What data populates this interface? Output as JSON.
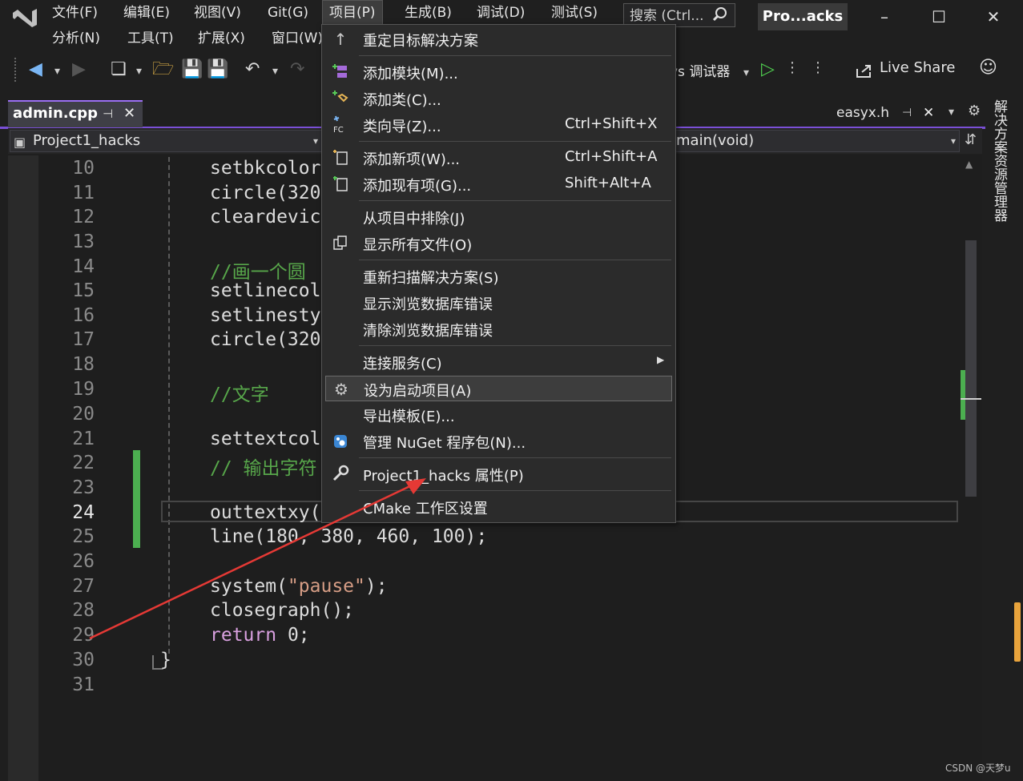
{
  "menubar": {
    "row1": [
      "文件(F)",
      "编辑(E)",
      "视图(V)",
      "Git(G)",
      "项目(P)",
      "生成(B)",
      "调试(D)",
      "测试(S)"
    ],
    "row2": [
      "分析(N)",
      "工具(T)",
      "扩展(X)",
      "窗口(W)"
    ],
    "search_placeholder": "搜索 (Ctrl...",
    "solution_name": "Pro...acks"
  },
  "toolbar": {
    "debugger_label": "vs 调试器",
    "live_share": "Live Share"
  },
  "tabs": {
    "active": "admin.cpp",
    "other": "easyx.h"
  },
  "navbar": {
    "scope": "Project1_hacks",
    "function": "main(void)"
  },
  "editor": {
    "lines": [
      {
        "n": "10",
        "code": "setbkcolor"
      },
      {
        "n": "11",
        "code": "circle(320"
      },
      {
        "n": "12",
        "code": "cleardevic"
      },
      {
        "n": "13",
        "code": ""
      },
      {
        "n": "14",
        "code": "//画一个圆"
      },
      {
        "n": "15",
        "code": "setlinecol"
      },
      {
        "n": "16",
        "code": "setlinesty"
      },
      {
        "n": "17",
        "code": "circle(320"
      },
      {
        "n": "18",
        "code": ""
      },
      {
        "n": "19",
        "code": "//文字"
      },
      {
        "n": "20",
        "code": ""
      },
      {
        "n": "21",
        "code": "settextcol"
      },
      {
        "n": "22",
        "code": "// 输出字符"
      },
      {
        "n": "23",
        "code": ""
      },
      {
        "n": "24",
        "code": "outtextxy("
      },
      {
        "n": "25",
        "code": "line(180, 380, 460, 100);"
      },
      {
        "n": "26",
        "code": ""
      },
      {
        "n": "27",
        "code_pre": "system(",
        "code_str": "\"pause\"",
        "code_post": ");"
      },
      {
        "n": "28",
        "code": "closegraph();"
      },
      {
        "n": "29",
        "code_kw": "return",
        "code_post": " 0;"
      },
      {
        "n": "30",
        "code": "}"
      },
      {
        "n": "31",
        "code": ""
      }
    ]
  },
  "project_menu": {
    "items": [
      {
        "label": "重定目标解决方案",
        "shortcut": "",
        "icon": "arrow-up-icon"
      },
      {
        "label": "添加模块(M)...",
        "shortcut": "",
        "icon": "add-module-icon"
      },
      {
        "label": "添加类(C)...",
        "shortcut": "",
        "icon": "add-class-icon"
      },
      {
        "label": "类向导(Z)...",
        "shortcut": "Ctrl+Shift+X",
        "icon": "class-wizard-icon"
      },
      {
        "label": "添加新项(W)...",
        "shortcut": "Ctrl+Shift+A",
        "icon": "add-new-item-icon"
      },
      {
        "label": "添加现有项(G)...",
        "shortcut": "Shift+Alt+A",
        "icon": "add-existing-item-icon"
      },
      {
        "label": "从项目中排除(J)",
        "shortcut": "",
        "icon": ""
      },
      {
        "label": "显示所有文件(O)",
        "shortcut": "",
        "icon": "show-all-files-icon"
      },
      {
        "label": "重新扫描解决方案(S)",
        "shortcut": "",
        "icon": ""
      },
      {
        "label": "显示浏览数据库错误",
        "shortcut": "",
        "icon": ""
      },
      {
        "label": "清除浏览数据库错误",
        "shortcut": "",
        "icon": ""
      },
      {
        "label": "连接服务(C)",
        "shortcut": "",
        "icon": ""
      },
      {
        "label": "设为启动项目(A)",
        "shortcut": "",
        "icon": "gear-icon"
      },
      {
        "label": "导出模板(E)...",
        "shortcut": "",
        "icon": ""
      },
      {
        "label": "管理 NuGet 程序包(N)...",
        "shortcut": "",
        "icon": "nuget-icon"
      },
      {
        "label": "Project1_hacks 属性(P)",
        "shortcut": "",
        "icon": "wrench-icon"
      },
      {
        "label": "CMake 工作区设置",
        "shortcut": "",
        "icon": ""
      }
    ]
  },
  "sidebar": {
    "solution_explorer": "解决方案资源管理器"
  },
  "watermark": "CSDN @天梦u",
  "colors": {
    "accent": "#9b6ef3",
    "annotation_arrow": "#e53935",
    "change_bar": "#4caf50"
  }
}
